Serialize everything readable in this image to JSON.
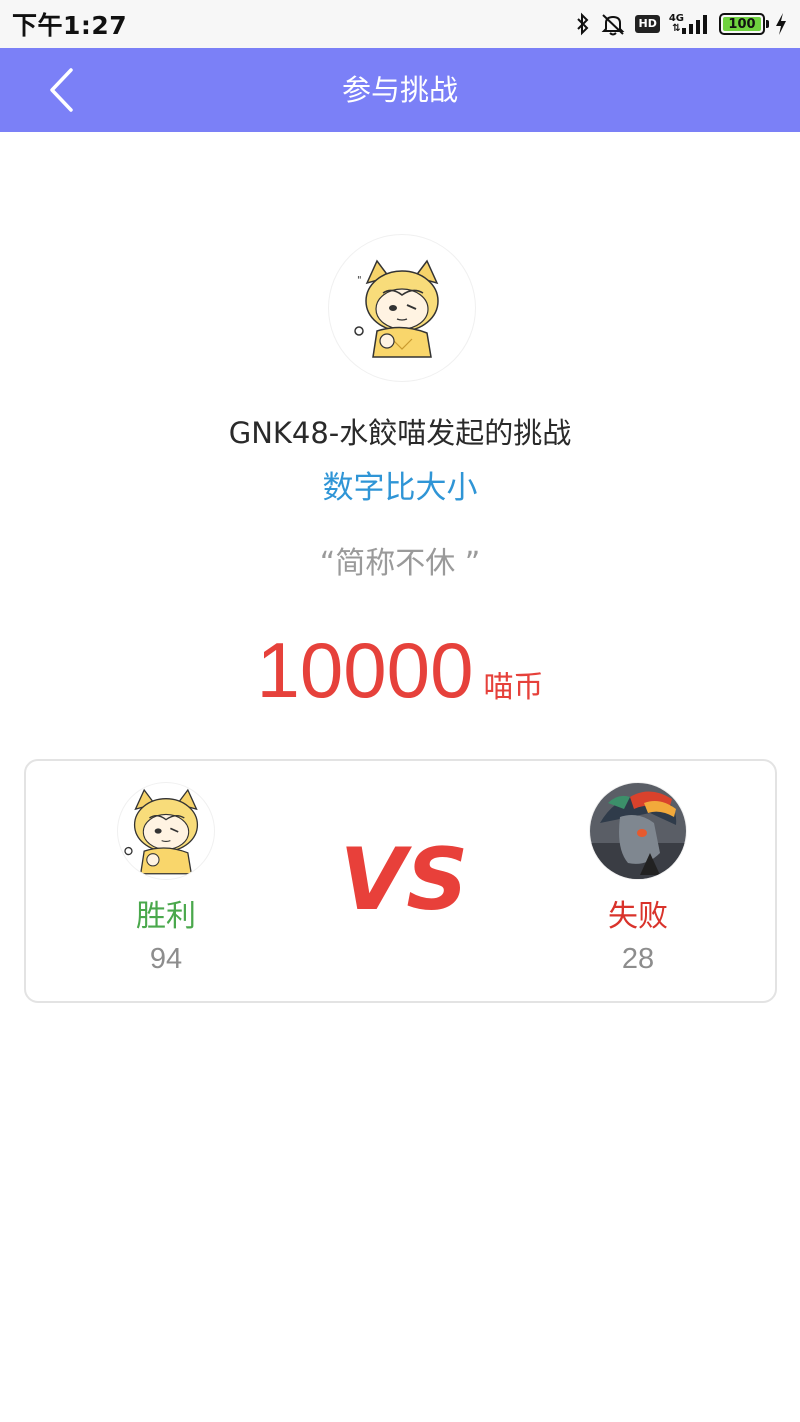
{
  "status_bar": {
    "time": "下午1:27",
    "hd_label": "HD",
    "network_label": "4G",
    "battery_label": "100"
  },
  "nav": {
    "title": "参与挑战",
    "back_icon": "chevron-left-icon"
  },
  "challenge": {
    "initiator_text": "GNK48-水餃喵发起的挑战",
    "game_name": "数字比大小",
    "slogan": "“简称不休 ”",
    "stake_amount": "10000",
    "stake_unit": "喵币"
  },
  "versus": {
    "vs_label": "VS",
    "left_player": {
      "result": "胜利",
      "score": "94"
    },
    "right_player": {
      "result": "失败",
      "score": "28"
    }
  },
  "colors": {
    "nav_bar": "#7b80f7",
    "game_name": "#2f95d6",
    "stake": "#e6413b",
    "win": "#4aa84c",
    "lose": "#d9332b",
    "vs": "#e8403a"
  }
}
